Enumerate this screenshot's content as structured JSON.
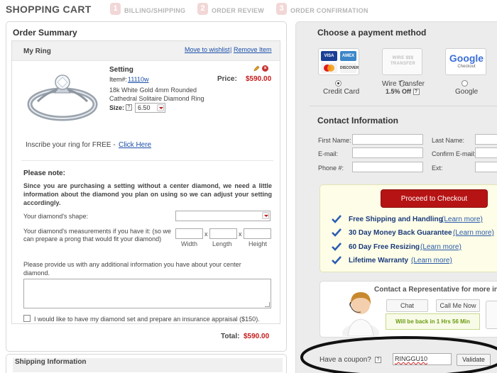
{
  "header": {
    "title": "SHOPPING CART",
    "steps": [
      {
        "num": "1",
        "label": "BILLING/SHIPPING"
      },
      {
        "num": "2",
        "label": "ORDER REVIEW"
      },
      {
        "num": "3",
        "label": "ORDER CONFIRMATION"
      }
    ]
  },
  "order_summary": {
    "title": "Order Summary",
    "ring_header": "My Ring",
    "wishlist_link": "Move to wishlist",
    "link_separator": "|",
    "remove_link": "Remove Item",
    "product": {
      "name": "Setting",
      "item_label": "Item#:",
      "item_number": "11110w",
      "description": "18k White Gold 4mm Rounded Cathedral Solitaire Diamond Ring",
      "size_label": "Size:",
      "size_value": "6.50",
      "price_label": "Price:",
      "price_value": "$590.00"
    },
    "inscribe_text": "Inscribe your ring for FREE -",
    "inscribe_link": "Click Here",
    "note_title": "Please note:",
    "note_body": "Since you are purchasing a setting without a center diamond, we need a little information about the diamond you plan on using so we can adjust your setting accordingly.",
    "shape_label": "Your diamond's shape:",
    "measurements_label": "Your diamond's measurements if you have it: (so we can prepare a prong that would fit your diamond)",
    "measure_x": "x",
    "measure_captions": [
      "Width",
      "Length",
      "Height"
    ],
    "extra_info_label": "Please provide us with any additional information you have about your center diamond.",
    "insurance_label": "I would like to have my diamond set and prepare an insurance appraisal ($150).",
    "total_label": "Total:",
    "total_value": "$590.00"
  },
  "shipping": {
    "title": "Shipping Information"
  },
  "payment": {
    "title": "Choose a payment method",
    "options": [
      {
        "label": "Credit Card",
        "selected": true
      },
      {
        "label": "Wire Transfer",
        "selected": false
      },
      {
        "label": "Google",
        "selected": false
      }
    ],
    "wire_discount": "1.5% Off",
    "wire_logo_text": "WIRE $$$ TRANSFER",
    "google_logo_text": "Google",
    "google_logo_sub": "Checkout",
    "card_brands": [
      "VISA",
      "AMEX",
      "MC",
      "DISCOVER"
    ]
  },
  "contact": {
    "title": "Contact Information",
    "fields": {
      "first_name": "First Name:",
      "last_name": "Last Name:",
      "email": "E-mail:",
      "confirm_email": "Confirm E-mail:",
      "phone": "Phone #:",
      "ext": "Ext:"
    }
  },
  "checkout": {
    "button": "Proceed to Checkout",
    "benefits": [
      {
        "text": "Free Shipping and Handling",
        "link": "(Learn more)"
      },
      {
        "text": "30 Day Money Back Guarantee",
        "link": "(Learn more)"
      },
      {
        "text": "60 Day Free Resizing",
        "link": "(Learn more)"
      },
      {
        "text": "Lifetime Warranty",
        "link": "(Learn more)"
      }
    ]
  },
  "representative": {
    "title": "Contact a Representative for more in",
    "chat": "Chat",
    "call_me": "Call Me Now",
    "back_in": "Will be back in 1 Hrs 56 Min"
  },
  "coupon": {
    "label": "Have a coupon?",
    "value": "RINGGU10",
    "button": "Validate"
  },
  "colors": {
    "price_red": "#c41a1a",
    "checkout_red": "#b61414",
    "link_blue": "#1a4ea8",
    "benefit_navy": "#1b3b7a",
    "back_in_green": "#6a9c11"
  }
}
